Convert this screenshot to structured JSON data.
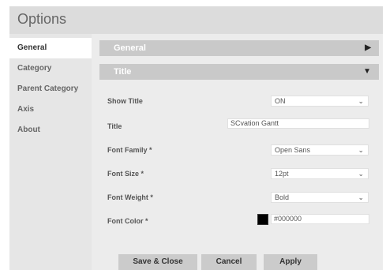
{
  "dialog": {
    "title": "Options"
  },
  "sidebar": {
    "items": [
      {
        "label": "General"
      },
      {
        "label": "Category"
      },
      {
        "label": "Parent Category"
      },
      {
        "label": "Axis"
      },
      {
        "label": "About"
      }
    ]
  },
  "sections": {
    "general": {
      "label": "General",
      "state": "collapsed"
    },
    "title": {
      "label": "Title",
      "state": "expanded"
    }
  },
  "fields": {
    "show_title": {
      "label": "Show Title",
      "value": "ON"
    },
    "title": {
      "label": "Title",
      "value": "SCvation Gantt"
    },
    "font_family": {
      "label": "Font Family *",
      "value": "Open Sans"
    },
    "font_size": {
      "label": "Font Size *",
      "value": "12pt"
    },
    "font_weight": {
      "label": "Font Weight *",
      "value": "Bold"
    },
    "font_color": {
      "label": "Font Color *",
      "value": "#000000",
      "swatch": "#000000"
    }
  },
  "buttons": {
    "save_close": "Save & Close",
    "cancel": "Cancel",
    "apply": "Apply"
  },
  "colors": {
    "titlebar": "#dcdcdc",
    "section_header": "#c9c9c9",
    "button": "#cbcbcb",
    "active_nav": "#ffffff"
  },
  "icons": {
    "collapsed": "triangle-right-icon",
    "expanded": "triangle-down-icon",
    "select": "chevron-down-icon"
  }
}
